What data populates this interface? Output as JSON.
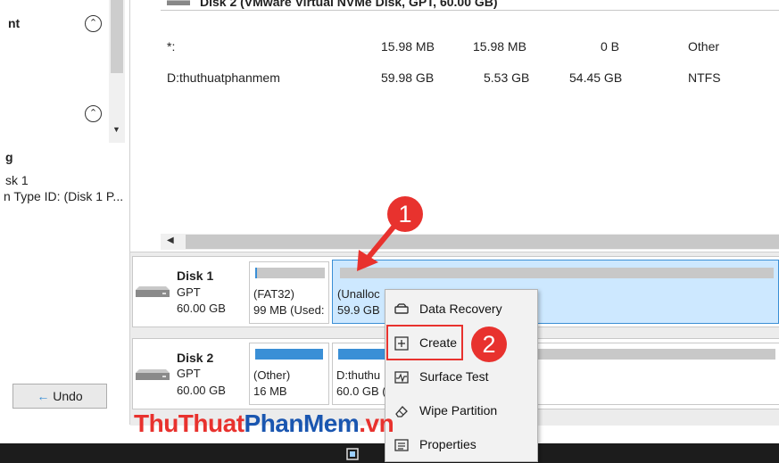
{
  "left_panel": {
    "heading_fragment": "nt",
    "g_fragment": "g",
    "disk_fragment": "sk 1",
    "typeid_fragment": "n Type ID: (Disk 1 P...",
    "undo_label": "Undo"
  },
  "main_table": {
    "disk_header": "Disk 2 (VMware Virtual NVMe Disk, GPT, 60.00 GB)",
    "rows": [
      {
        "name": "*:",
        "capacity": "15.98 MB",
        "used": "15.98 MB",
        "unused": "0 B",
        "fs": "Other"
      },
      {
        "name": "D:thuthuatphanmem",
        "capacity": "59.98 GB",
        "used": "5.53 GB",
        "unused": "54.45 GB",
        "fs": "NTFS"
      }
    ]
  },
  "disk_map": {
    "disk1": {
      "name": "Disk 1",
      "type": "GPT",
      "size": "60.00 GB",
      "partitions": [
        {
          "label": "(FAT32)",
          "detail": "99 MB (Used:"
        },
        {
          "label": "(Unalloc",
          "detail": "59.9 GB"
        }
      ]
    },
    "disk2": {
      "name": "Disk 2",
      "type": "GPT",
      "size": "60.00 GB",
      "partitions": [
        {
          "label": "(Other)",
          "detail": "16 MB"
        },
        {
          "label": "D:thuthu",
          "detail": "60.0 GB (U"
        }
      ]
    }
  },
  "context_menu": {
    "items": [
      {
        "label": "Data Recovery",
        "icon": "drive-icon"
      },
      {
        "label": "Create",
        "icon": "plus-box-icon"
      },
      {
        "label": "Surface Test",
        "icon": "pulse-icon"
      },
      {
        "label": "Wipe Partition",
        "icon": "eraser-icon"
      },
      {
        "label": "Properties",
        "icon": "properties-icon"
      }
    ]
  },
  "annotations": {
    "badge1": "1",
    "badge2": "2",
    "watermark_part1": "ThuThuat",
    "watermark_part2": "PhanMem",
    "watermark_part3": ".vn"
  },
  "colors": {
    "accent_blue": "#3a8fd6",
    "selected_bg": "#cde8ff",
    "badge_red": "#e8322e",
    "highlight_red": "#e8322e"
  }
}
